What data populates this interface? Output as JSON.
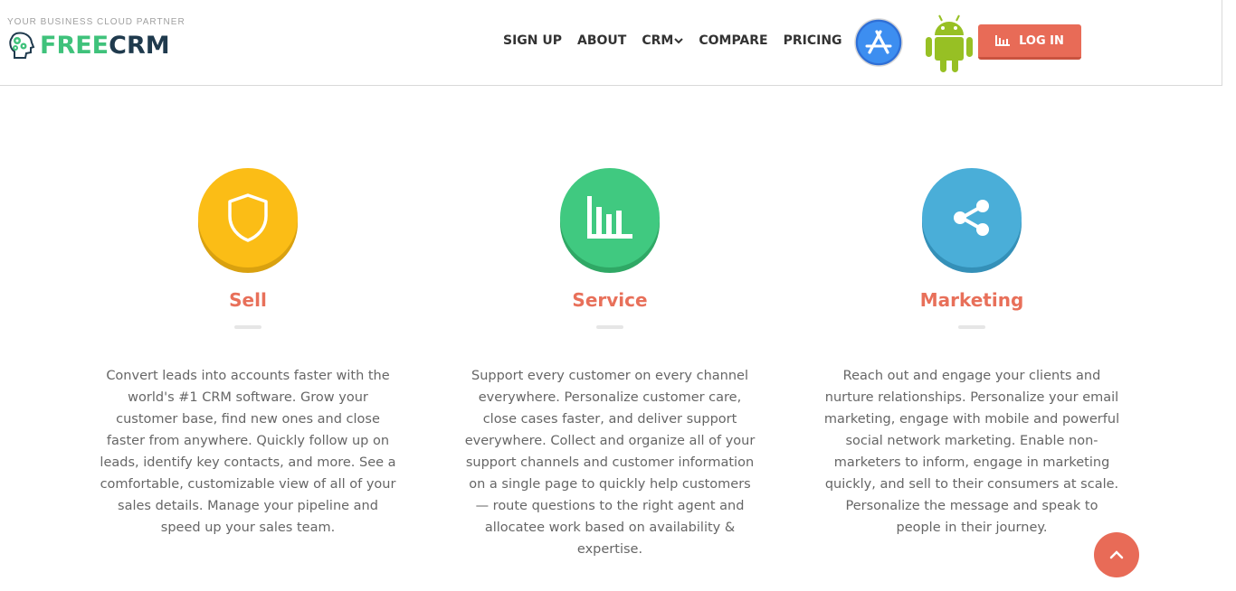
{
  "header": {
    "tagline": "YOUR BUSINESS CLOUD PARTNER",
    "logo_part1": "FREE",
    "logo_part2": "CRM",
    "nav": [
      {
        "label": "SIGN UP"
      },
      {
        "label": "ABOUT"
      },
      {
        "label": "CRM",
        "has_dropdown": true
      },
      {
        "label": "COMPARE"
      },
      {
        "label": "PRICING"
      }
    ],
    "login_label": "LOG IN",
    "icons": [
      "app-store-icon",
      "android-icon",
      "bar-chart-icon"
    ]
  },
  "features": [
    {
      "icon": "shield-icon",
      "color": "#fbbd16",
      "title": "Sell",
      "text": "Convert leads into accounts faster with the world's #1 CRM software. Grow your customer base, find new ones and close faster from anywhere. Quickly follow up on leads, identify key contacts, and more. See a comfortable, customizable view of all of your sales details. Manage your pipeline and speed up your sales team."
    },
    {
      "icon": "bar-chart-icon",
      "color": "#40c980",
      "title": "Service",
      "text": "Support every customer on every channel everywhere. Personalize customer care, close cases faster, and deliver support everywhere. Collect and organize all of your support channels and customer information on a single page to quickly help customers — route questions to the right agent and allocatee work based on availability & expertise."
    },
    {
      "icon": "share-icon",
      "color": "#4aaed8",
      "title": "Marketing",
      "text": "Reach out and engage your clients and nurture relationships. Personalize your email marketing, engage with mobile and powerful social network marketing. Enable non-marketers to inform, engage in marketing quickly, and sell to their consumers at scale. Personalize the message and speak to people in their journey."
    }
  ],
  "colors": {
    "accent": "#e86b57",
    "title": "#e8705a",
    "logo_green": "#3fc27b",
    "logo_dark": "#1f3a4d"
  },
  "scroll_top_icon": "chevron-up-icon"
}
